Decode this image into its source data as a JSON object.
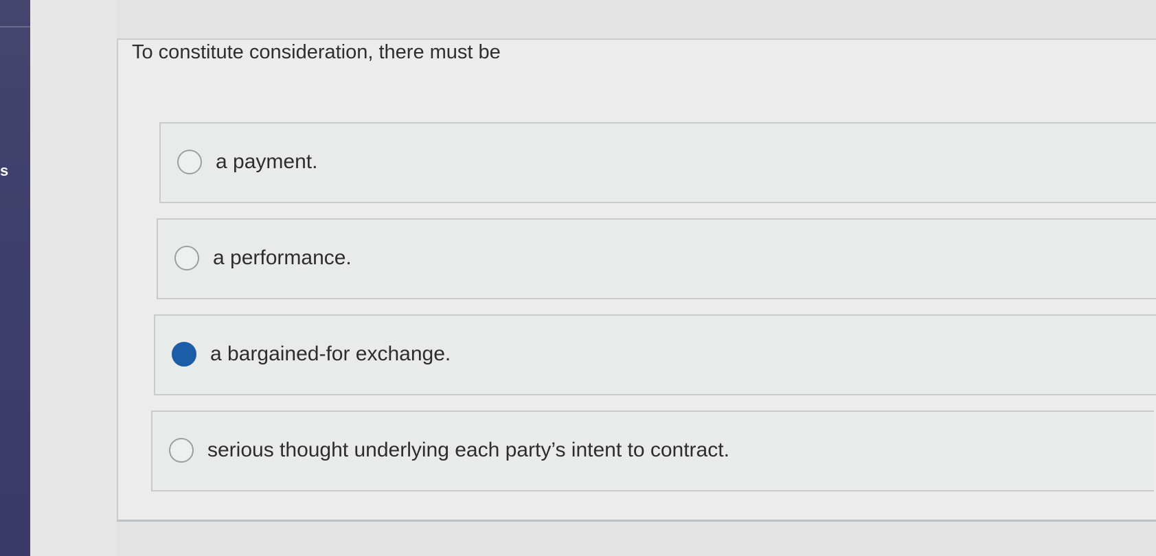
{
  "sidebar": {
    "letter": "s"
  },
  "question": {
    "text": "To constitute consideration, there must be"
  },
  "options": [
    {
      "label": "a payment.",
      "selected": false
    },
    {
      "label": "a performance.",
      "selected": false
    },
    {
      "label": "a bargained-for exchange.",
      "selected": true
    },
    {
      "label": "serious thought underlying each party’s intent to contract.",
      "selected": false
    }
  ],
  "colors": {
    "selected_radio": "#1b5da6",
    "sidebar": "#3f3f6b"
  }
}
